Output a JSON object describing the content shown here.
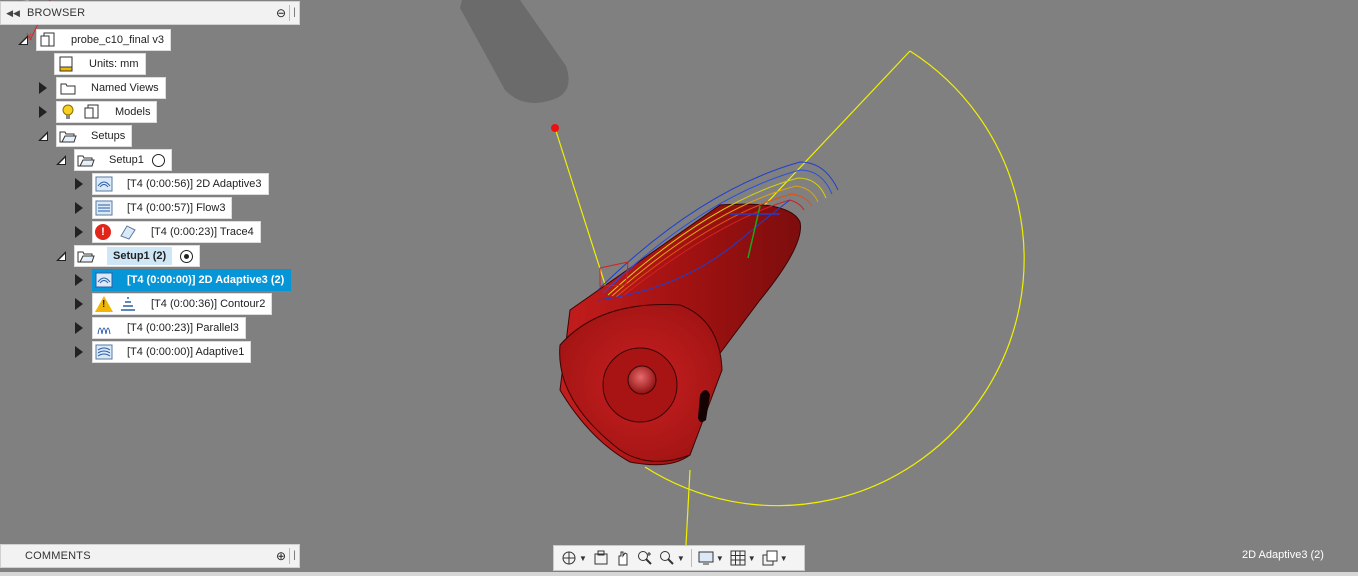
{
  "browser": {
    "title": "BROWSER",
    "collapse_icon": "double-left-arrow",
    "action_icon": "minus-circle",
    "document_name": "probe_c10_final v3",
    "units_label": "Units: mm",
    "named_views_label": "Named Views",
    "models_label": "Models",
    "setups_label": "Setups",
    "setup1": {
      "label": "Setup1",
      "operations": [
        {
          "label": "[T4 (0:00:56)] 2D Adaptive3",
          "icon": "adaptive-2d-icon"
        },
        {
          "label": "[T4 (0:00:57)] Flow3",
          "icon": "flow-icon"
        },
        {
          "label": "[T4 (0:00:23)] Trace4",
          "icon": "trace-icon",
          "status": "error"
        }
      ]
    },
    "setup2": {
      "label": "Setup1 (2)",
      "operations": [
        {
          "label": "[T4 (0:00:00)] 2D Adaptive3 (2)",
          "icon": "adaptive-2d-icon",
          "selected": true
        },
        {
          "label": "[T4 (0:00:36)] Contour2",
          "icon": "contour-icon",
          "status": "warning"
        },
        {
          "label": "[T4 (0:00:23)] Parallel3",
          "icon": "parallel-icon"
        },
        {
          "label": "[T4 (0:00:00)] Adaptive1",
          "icon": "adaptive-icon"
        }
      ]
    }
  },
  "comments": {
    "title": "COMMENTS",
    "action_icon": "plus-circle"
  },
  "nav_toolbar": {
    "tools": [
      "orbit-icon",
      "look-at-icon",
      "pan-icon",
      "zoom-icon",
      "fit-icon",
      "display-settings-icon",
      "grid-icon",
      "viewports-icon"
    ]
  },
  "status": {
    "operation_name": "2D Adaptive3 (2)"
  },
  "colors": {
    "viewport_bg": "#808080",
    "part_red": "#b01515",
    "selection_blue": "#0696d7",
    "toolpath_yellow": "#e6e600",
    "error_red": "#e1251b",
    "warning_yellow": "#f2b705"
  }
}
